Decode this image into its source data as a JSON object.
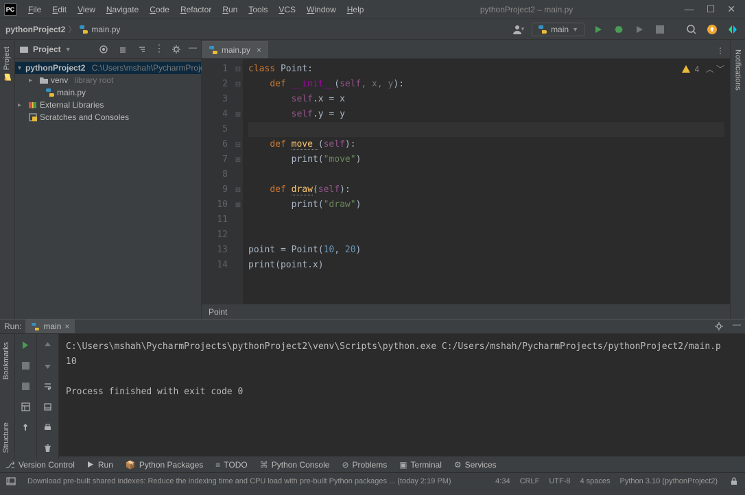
{
  "app_icon_text": "PC",
  "menus": [
    "File",
    "Edit",
    "View",
    "Navigate",
    "Code",
    "Refactor",
    "Run",
    "Tools",
    "VCS",
    "Window",
    "Help"
  ],
  "window_title": "pythonProject2 – main.py",
  "breadcrumb": {
    "project": "pythonProject2",
    "file": "main.py"
  },
  "run_config": {
    "label": "main"
  },
  "project_panel": {
    "title": "Project",
    "project_name": "pythonProject2",
    "project_path": "C:\\Users\\mshah\\PycharmProjects",
    "venv": "venv",
    "venv_hint": "library root",
    "file": "main.py",
    "external": "External Libraries",
    "scratches": "Scratches and Consoles"
  },
  "editor": {
    "tab_label": "main.py",
    "line_numbers": [
      "1",
      "2",
      "3",
      "4",
      "5",
      "6",
      "7",
      "8",
      "9",
      "10",
      "11",
      "12",
      "13",
      "14"
    ],
    "analysis": {
      "warn_count": "4"
    },
    "crumb": "Point",
    "code": [
      {
        "tokens": [
          [
            "kw",
            "class"
          ],
          [
            "",
            " "
          ],
          [
            "",
            "Point:"
          ]
        ]
      },
      {
        "tokens": [
          [
            "",
            "    "
          ],
          [
            "kw",
            "def"
          ],
          [
            "",
            " "
          ],
          [
            "mg",
            "__init__"
          ],
          [
            "",
            "("
          ],
          [
            "se",
            "self"
          ],
          [
            "pa",
            ", "
          ],
          [
            "pa",
            "x"
          ],
          [
            "pa",
            ", "
          ],
          [
            "pa",
            "y"
          ],
          [
            "",
            ")"
          ],
          [
            "",
            ":"
          ]
        ]
      },
      {
        "tokens": [
          [
            "",
            "        "
          ],
          [
            "se",
            "self"
          ],
          [
            "",
            ".x = x"
          ]
        ]
      },
      {
        "tokens": [
          [
            "",
            "        "
          ],
          [
            "se",
            "self"
          ],
          [
            "",
            ".y = y"
          ]
        ]
      },
      {
        "tokens": [
          [
            "",
            ""
          ]
        ],
        "hl": true
      },
      {
        "tokens": [
          [
            "",
            "    "
          ],
          [
            "kw",
            "def"
          ],
          [
            "",
            " "
          ],
          [
            "fn squiggle",
            "move "
          ],
          [
            "",
            "("
          ],
          [
            "se",
            "self"
          ],
          [
            "",
            ")"
          ],
          [
            "",
            ":"
          ]
        ]
      },
      {
        "tokens": [
          [
            "",
            "        "
          ],
          [
            "",
            "print("
          ],
          [
            "st",
            "\"move\""
          ],
          [
            "",
            ")"
          ]
        ]
      },
      {
        "tokens": [
          [
            "",
            ""
          ]
        ]
      },
      {
        "tokens": [
          [
            "",
            "    "
          ],
          [
            "kw",
            "def"
          ],
          [
            "",
            " "
          ],
          [
            "fn squiggle",
            "draw"
          ],
          [
            "",
            "("
          ],
          [
            "se",
            "self"
          ],
          [
            "",
            ")"
          ],
          [
            "",
            ":"
          ]
        ]
      },
      {
        "tokens": [
          [
            "",
            "        "
          ],
          [
            "",
            "print("
          ],
          [
            "st",
            "\"draw\""
          ],
          [
            "",
            ")"
          ]
        ]
      },
      {
        "tokens": [
          [
            "",
            ""
          ]
        ]
      },
      {
        "tokens": [
          [
            "",
            ""
          ]
        ]
      },
      {
        "tokens": [
          [
            "",
            "point = Point("
          ],
          [
            "nu",
            "10"
          ],
          [
            "",
            ", "
          ],
          [
            "nu",
            "20"
          ],
          [
            "",
            ")"
          ]
        ]
      },
      {
        "tokens": [
          [
            "",
            "print(point.x)"
          ]
        ]
      }
    ]
  },
  "run_output": {
    "tab_label": "main",
    "panel_title": "Run:",
    "lines": [
      "C:\\Users\\mshah\\PycharmProjects\\pythonProject2\\venv\\Scripts\\python.exe C:/Users/mshah/PycharmProjects/pythonProject2/main.p",
      "10",
      "",
      "Process finished with exit code 0"
    ]
  },
  "left_v_tabs": [
    "Project"
  ],
  "left_v_tabs_lower": [
    "Bookmarks",
    "Structure"
  ],
  "right_v_tabs": [
    "Notifications"
  ],
  "bottom_tools": [
    "Version Control",
    "Run",
    "Python Packages",
    "TODO",
    "Python Console",
    "Problems",
    "Terminal",
    "Services"
  ],
  "status": {
    "msg": "Download pre-built shared indexes: Reduce the indexing time and CPU load with pre-built Python packages ... (today 2:19 PM)",
    "pos": "4:34",
    "eol": "CRLF",
    "enc": "UTF-8",
    "indent": "4 spaces",
    "interpreter": "Python 3.10 (pythonProject2)"
  }
}
